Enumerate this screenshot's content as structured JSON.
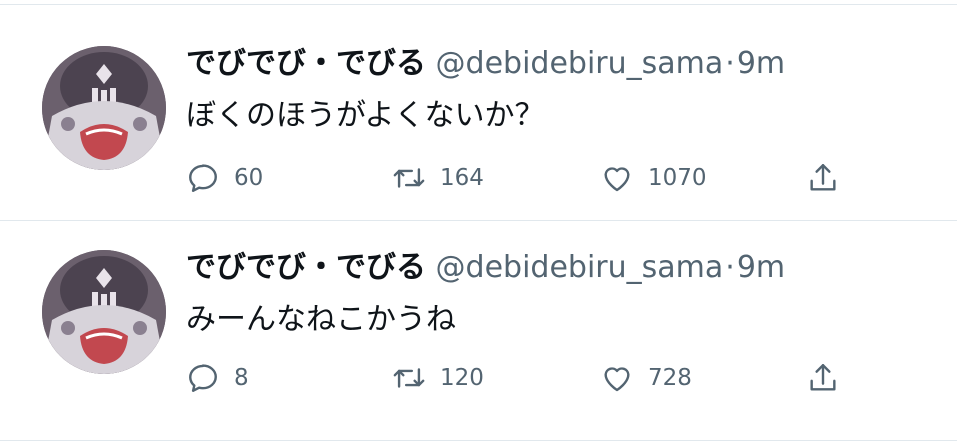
{
  "tweets": [
    {
      "display_name": "でびでび・でびる",
      "handle": "@debidebiru_sama",
      "separator": "·",
      "time": "9m",
      "text": "ぼくのほうがよくないか？",
      "replies": "60",
      "retweets": "164",
      "likes": "1070",
      "icons": {
        "reply": "reply-icon",
        "retweet": "retweet-icon",
        "like": "heart-icon",
        "share": "share-icon"
      }
    },
    {
      "display_name": "でびでび・でびる",
      "handle": "@debidebiru_sama",
      "separator": "·",
      "time": "9m",
      "text": "みーんなねこかうね",
      "replies": "8",
      "retweets": "120",
      "likes": "728",
      "icons": {
        "reply": "reply-icon",
        "retweet": "retweet-icon",
        "like": "heart-icon",
        "share": "share-icon"
      }
    }
  ],
  "colors": {
    "text_primary": "#0f1419",
    "text_secondary": "#536471",
    "divider": "#e1e8ed",
    "avatar_bg": "#6a5f6b"
  }
}
